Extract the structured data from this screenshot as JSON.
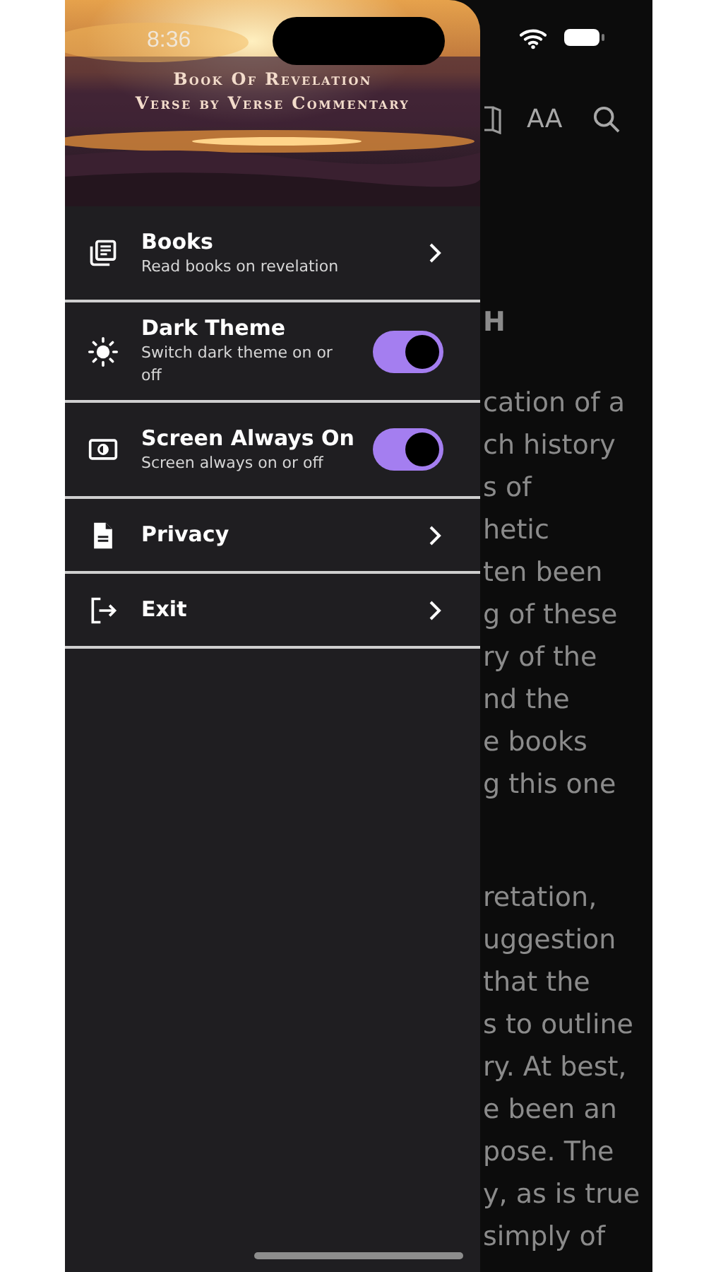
{
  "status_bar": {
    "time": "8:36"
  },
  "drawer": {
    "header": {
      "title_lines": [
        "Book Of Revelation",
        "Verse by Verse Commentary"
      ]
    },
    "items": [
      {
        "kind": "link",
        "title": "Books",
        "subtitle": "Read books on revelation"
      },
      {
        "kind": "toggle",
        "title": "Dark Theme",
        "subtitle": "Switch dark theme on or off",
        "on": true
      },
      {
        "kind": "toggle",
        "title": "Screen Always On",
        "subtitle": "Screen always on or off",
        "on": true
      },
      {
        "kind": "link",
        "title": "Privacy"
      },
      {
        "kind": "link",
        "title": "Exit"
      }
    ]
  },
  "toolbar": {
    "font_size_label": "AA"
  },
  "reader": {
    "heading": "H",
    "paragraphs": [
      [
        "cation of a",
        "ch history",
        "s of",
        "hetic",
        "ten been",
        "g of these",
        "ry of the",
        "nd the",
        "e books",
        "g this one"
      ],
      [
        "retation,",
        "uggestion",
        "that the",
        "s to outline",
        "ry. At best,",
        "e been an",
        "pose. The",
        "y, as is true",
        "simply of"
      ]
    ]
  }
}
